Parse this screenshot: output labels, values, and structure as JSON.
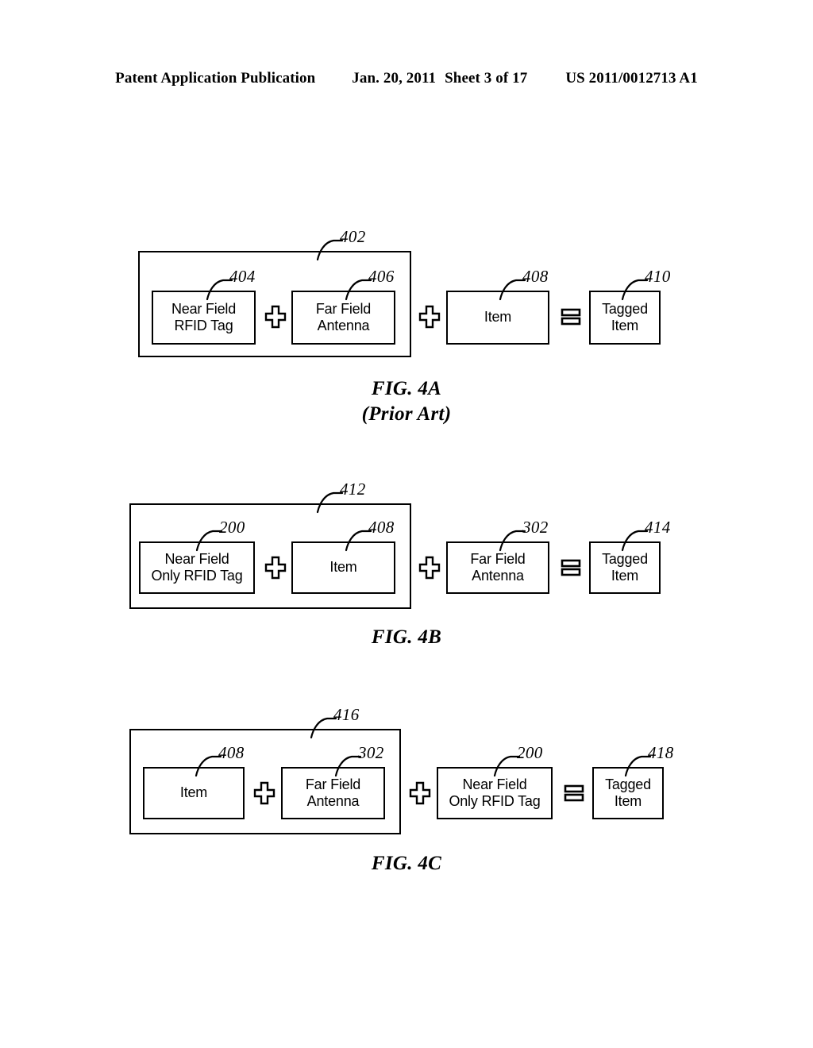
{
  "header": {
    "publication": "Patent Application Publication",
    "date": "Jan. 20, 2011",
    "sheet": "Sheet 3 of 17",
    "document_number": "US 2011/0012713 A1"
  },
  "operators": {
    "plus": "plus-sign",
    "equals": "equals-sign"
  },
  "figures": [
    {
      "id": "fig-4a",
      "caption": "FIG. 4A\n(Prior Art)",
      "group_ref": "402",
      "boxes": [
        {
          "ref": "404",
          "label": "Near Field\nRFID Tag",
          "in_group": true
        },
        {
          "ref": "406",
          "label": "Far Field\nAntenna",
          "in_group": true
        },
        {
          "ref": "408",
          "label": "Item",
          "in_group": false
        },
        {
          "ref": "410",
          "label": "Tagged\nItem",
          "in_group": false
        }
      ],
      "operator_sequence": [
        "plus",
        "plus",
        "equals"
      ]
    },
    {
      "id": "fig-4b",
      "caption": "FIG. 4B",
      "group_ref": "412",
      "boxes": [
        {
          "ref": "200",
          "label": "Near Field\nOnly RFID Tag",
          "in_group": true
        },
        {
          "ref": "408",
          "label": "Item",
          "in_group": true
        },
        {
          "ref": "302",
          "label": "Far Field\nAntenna",
          "in_group": false
        },
        {
          "ref": "414",
          "label": "Tagged\nItem",
          "in_group": false
        }
      ],
      "operator_sequence": [
        "plus",
        "plus",
        "equals"
      ]
    },
    {
      "id": "fig-4c",
      "caption": "FIG. 4C",
      "group_ref": "416",
      "boxes": [
        {
          "ref": "408",
          "label": "Item",
          "in_group": true
        },
        {
          "ref": "302",
          "label": "Far Field\nAntenna",
          "in_group": true
        },
        {
          "ref": "200",
          "label": "Near Field\nOnly RFID Tag",
          "in_group": false
        },
        {
          "ref": "418",
          "label": "Tagged\nItem",
          "in_group": false
        }
      ],
      "operator_sequence": [
        "plus",
        "plus",
        "equals"
      ]
    }
  ]
}
